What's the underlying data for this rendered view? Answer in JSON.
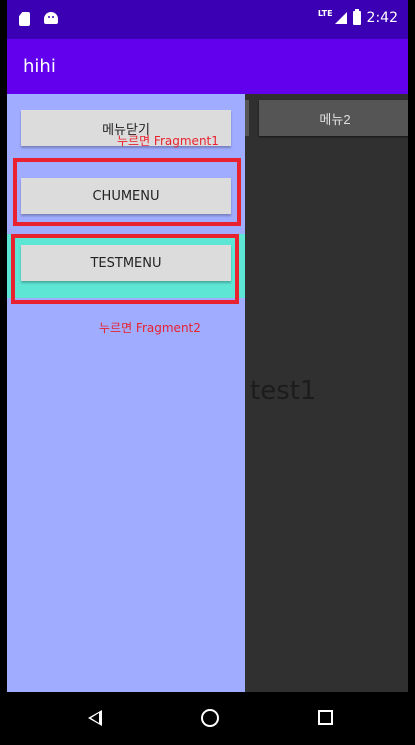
{
  "status_bar": {
    "time": "2:42",
    "network": "LTE"
  },
  "app_bar": {
    "title": "hihi"
  },
  "content": {
    "menu2_label": "메뉴2",
    "fragment_text": "test1"
  },
  "drawer": {
    "close_label": "메뉴닫기",
    "chumenu_label": "CHUMENU",
    "testmenu_label": "TESTMENU"
  },
  "annotations": {
    "fragment1": "누르면 Fragment1",
    "fragment2": "누르면 Fragment2"
  },
  "colors": {
    "status_bar": "#3b00b3",
    "app_bar": "#6200ee",
    "drawer": "#a0acff",
    "highlight": "#5ee6d4",
    "annotation_red": "#e8222e"
  }
}
